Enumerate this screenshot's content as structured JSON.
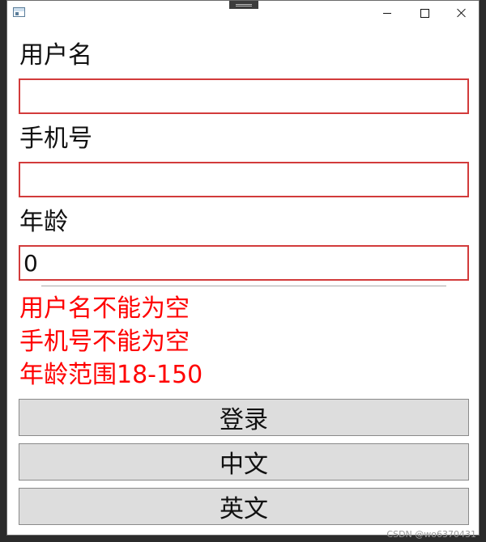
{
  "window": {
    "icon": "app-window-icon",
    "controls": [
      "minimize-icon",
      "maximize-icon",
      "close-icon"
    ]
  },
  "form": {
    "username_label": "用户名",
    "username_value": "",
    "phone_label": "手机号",
    "phone_value": "",
    "age_label": "年龄",
    "age_value": "0",
    "invalid_border_color": "#d23b3b"
  },
  "errors": {
    "color": "#ff0000",
    "messages": [
      "用户名不能为空",
      "手机号不能为空",
      "年龄范围18-150"
    ]
  },
  "buttons": {
    "login_label": "登录",
    "chinese_label": "中文",
    "english_label": "英文"
  },
  "watermark": "CSDN @wo6370431"
}
